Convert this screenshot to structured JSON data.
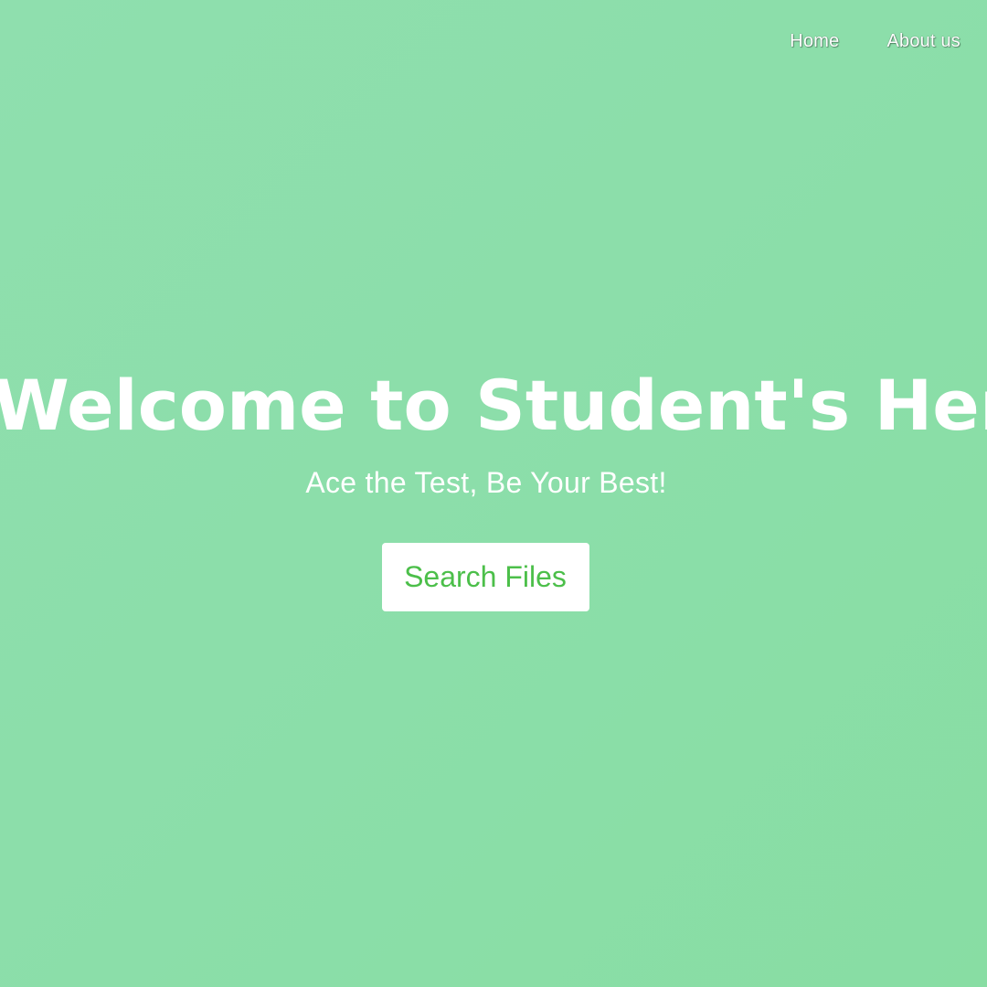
{
  "nav": {
    "items": [
      {
        "label": "Home"
      },
      {
        "label": "About us"
      }
    ]
  },
  "hero": {
    "title": "Welcome to Student's Hero",
    "subtitle": "Ace the Test, Be Your Best!",
    "cta_label": "Search Files"
  },
  "colors": {
    "background": "#8bdea9",
    "text": "#ffffff",
    "button_background": "#ffffff",
    "button_text": "#4cbf4a"
  }
}
